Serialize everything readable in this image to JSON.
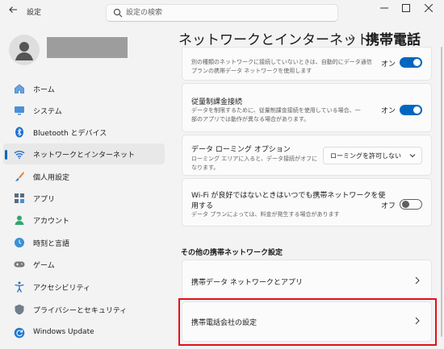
{
  "window": {
    "app_title": "設定",
    "back_icon": "back-arrow-icon",
    "controls": [
      "minimize-icon",
      "maximize-icon",
      "close-icon"
    ]
  },
  "search": {
    "placeholder": "設定の検索",
    "value": ""
  },
  "profile": {
    "avatar_icon": "person-icon"
  },
  "sidebar": {
    "items": [
      {
        "label": "ホーム",
        "icon": "home-icon",
        "selected": false
      },
      {
        "label": "システム",
        "icon": "monitor-icon",
        "selected": false
      },
      {
        "label": "Bluetooth とデバイス",
        "icon": "bluetooth-icon",
        "selected": false
      },
      {
        "label": "ネットワークとインターネット",
        "icon": "wifi-icon",
        "selected": true
      },
      {
        "label": "個人用設定",
        "icon": "brush-icon",
        "selected": false
      },
      {
        "label": "アプリ",
        "icon": "apps-icon",
        "selected": false
      },
      {
        "label": "アカウント",
        "icon": "account-icon",
        "selected": false
      },
      {
        "label": "時刻と言語",
        "icon": "globe-clock-icon",
        "selected": false
      },
      {
        "label": "ゲーム",
        "icon": "gamepad-icon",
        "selected": false
      },
      {
        "label": "アクセシビリティ",
        "icon": "accessibility-icon",
        "selected": false
      },
      {
        "label": "プライバシーとセキュリティ",
        "icon": "shield-icon",
        "selected": false
      },
      {
        "label": "Windows Update",
        "icon": "update-icon",
        "selected": false
      }
    ]
  },
  "header": {
    "parent": "ネットワークとインターネット",
    "separator": "›",
    "current": "携帯電話"
  },
  "settings": {
    "partial_card": {
      "desc_line1": "別の種類のネットワークに接続していないときは、自動的にデータ通信",
      "desc_line2": "プランの携帯データ ネットワークを使用します",
      "toggle_label": "オン",
      "toggle_on": true
    },
    "metered": {
      "title": "従量制課金接続",
      "desc_line1": "データを制限するために、従量制課金接続を使用している場合、一",
      "desc_line2": "部のアプリでは動作が異なる場合があります。",
      "toggle_label": "オン",
      "toggle_on": true
    },
    "roaming": {
      "title": "データ ローミング オプション",
      "desc_line1": "ローミング エリアに入ると、データ接続がオフに",
      "desc_line2": "なります。",
      "dropdown_value": "ローミングを許可しない"
    },
    "wifi_pref": {
      "title_line1": "Wi-Fi が良好ではないときはいつでも携帯ネットワークを使",
      "title_line2": "用する",
      "desc": "データ プランによっては、料金が発生する場合があります",
      "toggle_label": "オフ",
      "toggle_on": false
    }
  },
  "other_section": {
    "header": "その他の携帯ネットワーク設定",
    "links": [
      {
        "label": "携帯データ ネットワークとアプリ"
      },
      {
        "label": "携帯電話会社の設定"
      }
    ]
  },
  "colors": {
    "accent": "#0067c0",
    "highlight": "#e0101a"
  }
}
